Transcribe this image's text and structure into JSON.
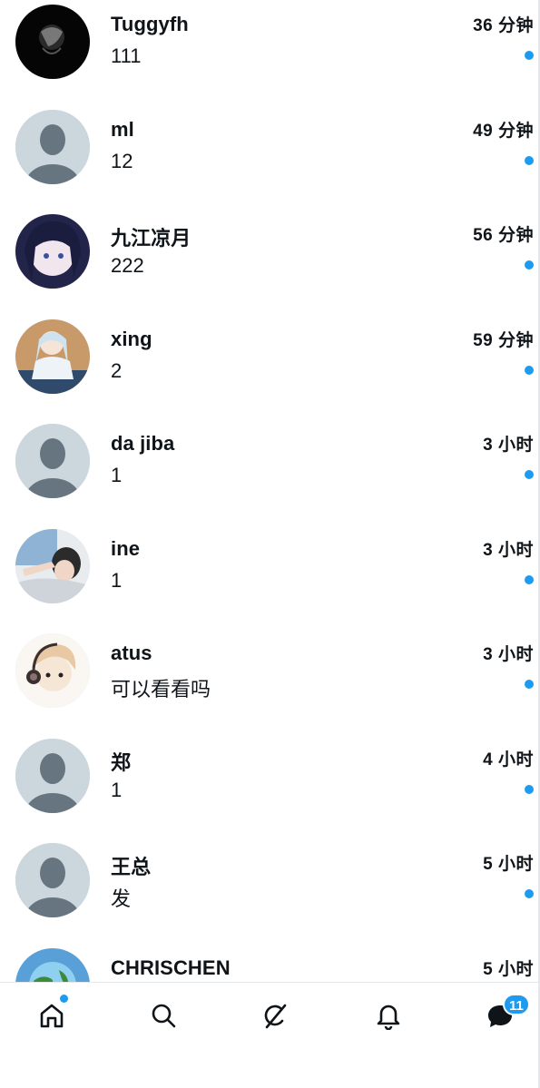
{
  "conversations": [
    {
      "name": "Tuggyfh",
      "preview": "111",
      "time": "36 分钟",
      "unread": true,
      "avatar": "dark-photo"
    },
    {
      "name": "ml",
      "preview": "12",
      "time": "49 分钟",
      "unread": true,
      "avatar": "default"
    },
    {
      "name": "九江凉月",
      "preview": "222",
      "time": "56 分钟",
      "unread": true,
      "avatar": "anime-dark-hair"
    },
    {
      "name": "xing",
      "preview": "2",
      "time": "59 分钟",
      "unread": true,
      "avatar": "anime-girl-sitting"
    },
    {
      "name": "da jiba",
      "preview": "1",
      "time": "3 小时",
      "unread": true,
      "avatar": "default"
    },
    {
      "name": "ine",
      "preview": "1",
      "time": "3 小时",
      "unread": true,
      "avatar": "person-lying-photo"
    },
    {
      "name": "atus",
      "preview": "可以看看吗",
      "time": "3 小时",
      "unread": true,
      "avatar": "anime-headphones"
    },
    {
      "name": "郑",
      "preview": "1",
      "time": "4 小时",
      "unread": true,
      "avatar": "default"
    },
    {
      "name": "王总",
      "preview": "发",
      "time": "5 小时",
      "unread": true,
      "avatar": "default"
    },
    {
      "name": "CHRISCHEN",
      "preview": "",
      "time": "5 小时",
      "unread": false,
      "avatar": "blue-globe"
    }
  ],
  "tabbar": {
    "tabs": [
      {
        "name": "tab-home",
        "icon": "home-icon"
      },
      {
        "name": "tab-search",
        "icon": "search-icon"
      },
      {
        "name": "tab-grok",
        "icon": "grok-icon"
      },
      {
        "name": "tab-notifications",
        "icon": "bell-icon"
      },
      {
        "name": "tab-messages",
        "icon": "messages-icon"
      }
    ],
    "messages_badge": "11"
  },
  "colors": {
    "accent": "#1d9bf0",
    "text": "#0f1419",
    "default_avatar_bg": "#ccd6dd",
    "default_avatar_fg": "#66757f",
    "divider": "#e4e7ea"
  }
}
